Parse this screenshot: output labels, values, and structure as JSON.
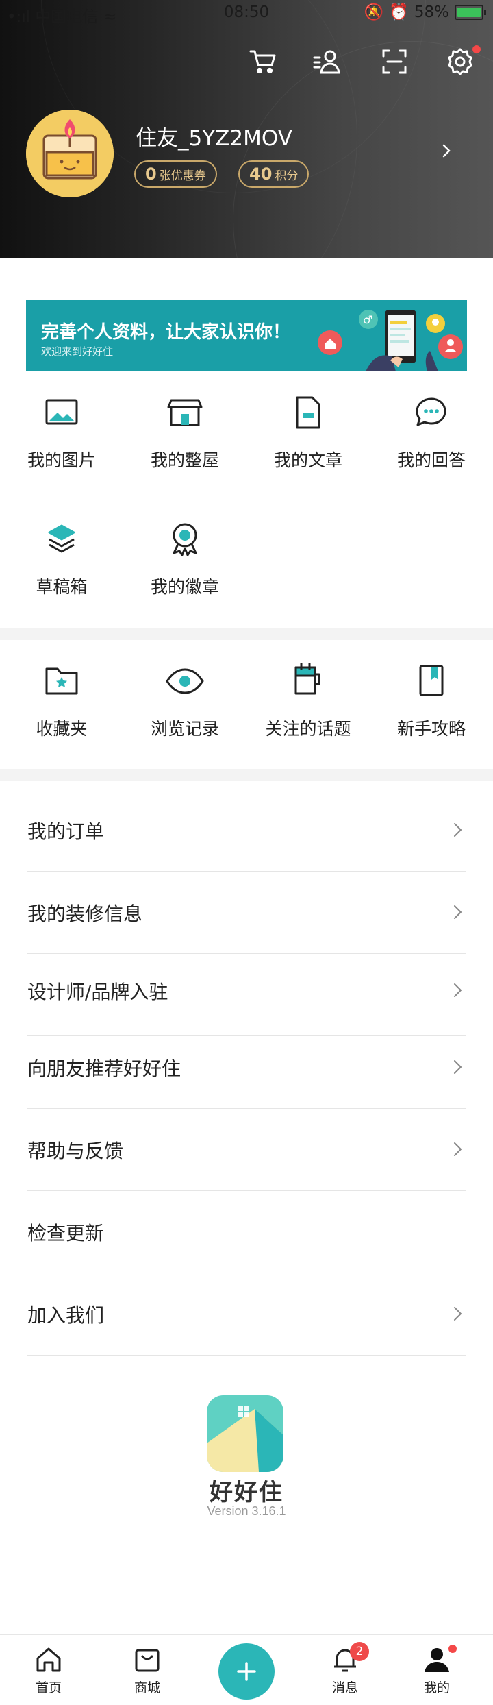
{
  "status_bar": {
    "carrier": "中国电信",
    "time": "08:50",
    "battery": "58%"
  },
  "profile": {
    "username": "住友_5YZ2MOV",
    "coupons_count": "0",
    "coupons_label": "张优惠券",
    "points_count": "40",
    "points_label": "积分"
  },
  "banner": {
    "title": "完善个人资料，让大家认识你！",
    "subtitle": "欢迎来到好好住"
  },
  "content_grid": [
    {
      "label": "我的图片",
      "icon": "picture-icon"
    },
    {
      "label": "我的整屋",
      "icon": "house-icon"
    },
    {
      "label": "我的文章",
      "icon": "article-icon"
    },
    {
      "label": "我的回答",
      "icon": "answer-icon"
    },
    {
      "label": "草稿箱",
      "icon": "drafts-icon"
    },
    {
      "label": "我的徽章",
      "icon": "badge-icon"
    }
  ],
  "collect_grid": [
    {
      "label": "收藏夹",
      "icon": "folder-icon"
    },
    {
      "label": "浏览记录",
      "icon": "eye-icon"
    },
    {
      "label": "关注的话题",
      "icon": "topic-icon"
    },
    {
      "label": "新手攻略",
      "icon": "guide-icon"
    }
  ],
  "menu": [
    {
      "label": "我的订单",
      "chevron": true
    },
    {
      "label": "我的装修信息",
      "chevron": true
    },
    {
      "label": "设计师/品牌入驻",
      "chevron": true
    },
    {
      "label": "向朋友推荐好好住",
      "chevron": true
    },
    {
      "label": "帮助与反馈",
      "chevron": true
    },
    {
      "label": "检查更新",
      "chevron": false
    },
    {
      "label": "加入我们",
      "chevron": true
    }
  ],
  "app": {
    "name": "好好住",
    "version": "Version 3.16.1"
  },
  "tabbar": {
    "home": "首页",
    "mall": "商城",
    "messages": "消息",
    "messages_badge": "2",
    "me": "我的"
  },
  "colors": {
    "accent": "#2bb6b7",
    "gold": "#e8c98e",
    "alert": "#f44848"
  }
}
